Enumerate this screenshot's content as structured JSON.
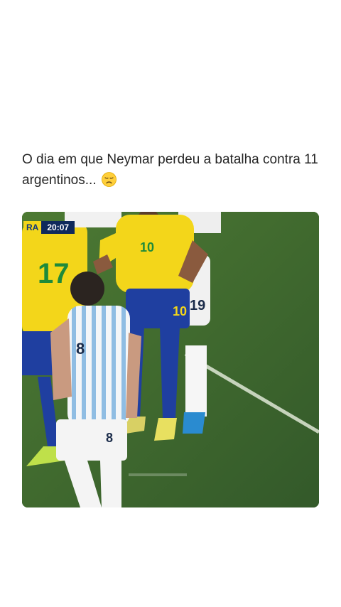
{
  "post": {
    "caption": "O dia em que Neymar perdeu a batalha contra 11 argentinos...",
    "emoji_icon": "disappointed-face-icon"
  },
  "media": {
    "kind": "video",
    "scoreboard": {
      "team_abbr": "RA",
      "clock": "20:07"
    },
    "jersey_numbers": [
      "17",
      "10",
      "10",
      "19",
      "8"
    ],
    "colors": {
      "pitch": "#3f6a2c",
      "brazil_yellow": "#f3d61a",
      "brazil_blue": "#1f3fa0",
      "argentina_stripe": "#8fbde3"
    }
  }
}
